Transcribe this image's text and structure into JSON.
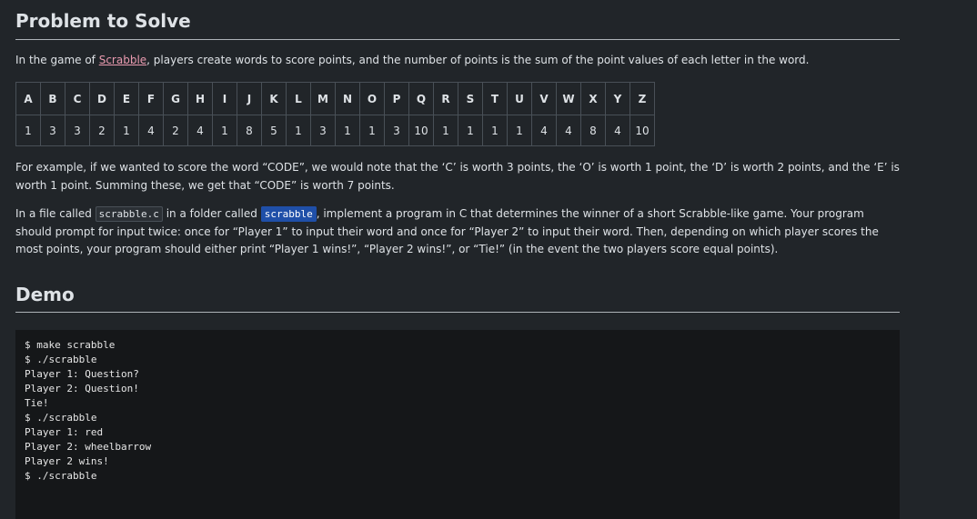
{
  "headings": {
    "problem": "Problem to Solve",
    "demo": "Demo"
  },
  "intro": {
    "before": "In the game of ",
    "link": "Scrabble",
    "after": ", players create words to score points, and the number of points is the sum of the point values of each letter in the word."
  },
  "score_table": {
    "letters": [
      "A",
      "B",
      "C",
      "D",
      "E",
      "F",
      "G",
      "H",
      "I",
      "J",
      "K",
      "L",
      "M",
      "N",
      "O",
      "P",
      "Q",
      "R",
      "S",
      "T",
      "U",
      "V",
      "W",
      "X",
      "Y",
      "Z"
    ],
    "points": [
      "1",
      "3",
      "3",
      "2",
      "1",
      "4",
      "2",
      "4",
      "1",
      "8",
      "5",
      "1",
      "3",
      "1",
      "1",
      "3",
      "10",
      "1",
      "1",
      "1",
      "1",
      "4",
      "4",
      "8",
      "4",
      "10"
    ]
  },
  "example": {
    "text": "For example, if we wanted to score the word “CODE”, we would note that the ‘C’ is worth 3 points, the ‘O’ is worth 1 point, the ‘D’ is worth 2 points, and the ‘E’ is worth 1 point. Summing these, we get that “CODE” is worth 7 points."
  },
  "task": {
    "t1": "In a file called ",
    "file": "scrabble.c",
    "t2": " in a folder called ",
    "folder": "scrabble",
    "t3": ", implement a program in C that determines the winner of a short Scrabble-like game. Your program should prompt for input twice: once for “Player 1” to input their word and once for “Player 2” to input their word. Then, depending on which player scores the most points, your program should either print “Player 1 wins!”, “Player 2 wins!”, or “Tie!” (in the event the two players score equal points)."
  },
  "terminal": {
    "lines": [
      "$ make scrabble",
      "$ ./scrabble",
      "Player 1: Question?",
      "Player 2: Question!",
      "Tie!",
      "$ ./scrabble",
      "Player 1: red",
      "Player 2: wheelbarrow",
      "Player 2 wins!",
      "$ ./scrabble"
    ]
  }
}
